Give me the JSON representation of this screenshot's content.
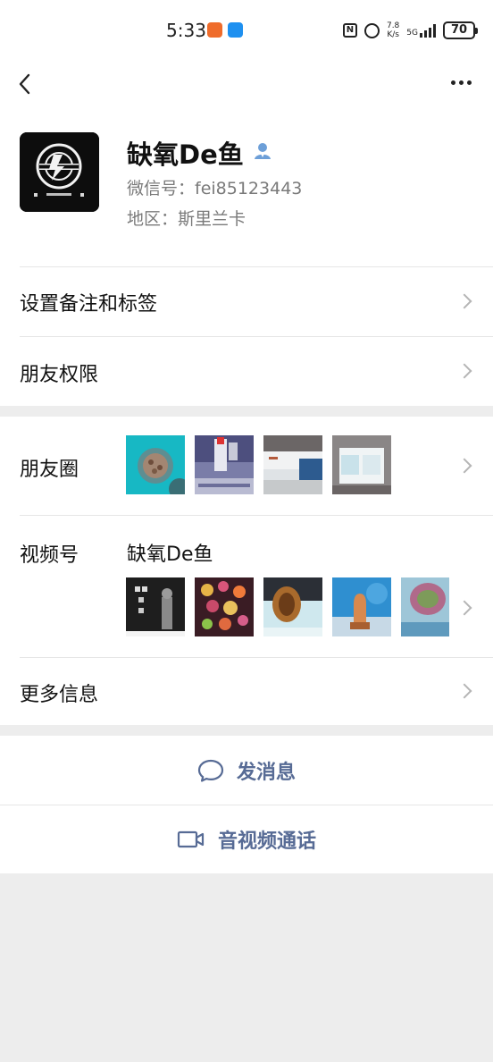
{
  "status_bar": {
    "time": "5:33",
    "net_speed_value": "7.8",
    "net_speed_unit": "K/s",
    "signal_label": "5G",
    "battery": "70"
  },
  "profile": {
    "nickname": "缺氧De鱼",
    "wechat_id": "微信号：fei85123443",
    "region": "地区：斯里兰卡"
  },
  "rows": {
    "remark_tags": "设置备注和标签",
    "friend_permissions": "朋友权限",
    "moments": "朋友圈",
    "channels": "视频号",
    "channels_name": "缺氧De鱼",
    "more_info": "更多信息"
  },
  "actions": {
    "send_message": "发消息",
    "video_call": "音视频通话"
  },
  "colors": {
    "link_blue": "#576b95",
    "background_gray": "#ededed",
    "verified_icon_blue": "#6d9fd8"
  }
}
